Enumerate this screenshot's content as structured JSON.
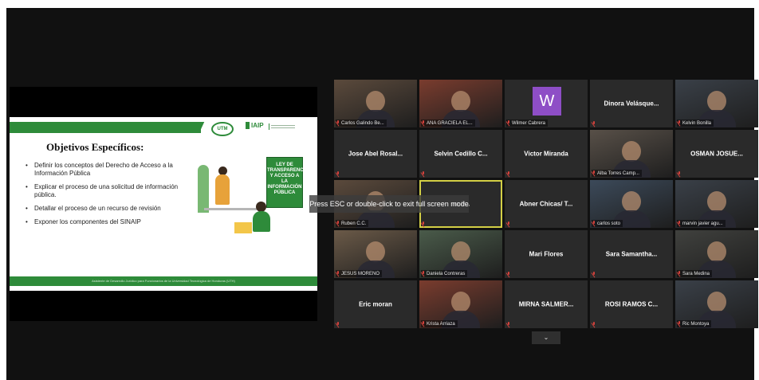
{
  "toast": "Press ESC or double-click to exit full screen mode",
  "slide": {
    "title": "Objetivos Específicos:",
    "bullets": [
      "Definir los conceptos del Derecho de Acceso a la Información Pública",
      "Explicar el proceso de una solicitud de información pública.",
      "Detallar el proceso de un recurso de revisión",
      "Exponer los componentes del SINAIP"
    ],
    "logo_utm": "UTM",
    "logo_iaip": "IAIP",
    "book_text": "LEY DE TRANSPARENCIA Y ACCESO A LA INFORMACIÓN PÚBLICA",
    "footer": "Asistente de Desarrollo Jurídico para Funcionarios de la Universidad Tecnológica de Honduras (UTH)"
  },
  "participants": [
    {
      "name": "Carlos Galindo Be...",
      "video": true,
      "label": "Carlos Galindo Be..."
    },
    {
      "name": "ANA GRACIELA EL...",
      "video": true,
      "label": "ANA GRACIELA EL..."
    },
    {
      "name": "Wilmer Cabrera",
      "avatar": "W",
      "label": "Wilmer Cabrera"
    },
    {
      "name": "Dinora Velásque...",
      "label": ""
    },
    {
      "name": "Kelvin Bonilla",
      "video": true,
      "label": "Kelvin Bonilla"
    },
    {
      "name": "Jose Abel Rosal...",
      "label": ""
    },
    {
      "name": "Selvin Cedillo C...",
      "label": ""
    },
    {
      "name": "Victor Miranda",
      "label": ""
    },
    {
      "name": "Alba Torres Camp...",
      "video": true,
      "label": "Alba Torres Camp..."
    },
    {
      "name": "OSMAN JOSUE...",
      "label": ""
    },
    {
      "name": "Ruben C.C.",
      "video": true,
      "label": "Ruben C.C."
    },
    {
      "name": "na P...",
      "label": "",
      "active": true
    },
    {
      "name": "Abner Chicas/ T...",
      "label": ""
    },
    {
      "name": "carlos soto",
      "video": true,
      "label": "carlos soto"
    },
    {
      "name": "marvin javier agu...",
      "video": true,
      "label": "marvin javier agu..."
    },
    {
      "name": "JESUS MORENO",
      "video": true,
      "label": "JESUS MORENO"
    },
    {
      "name": "Daniela Contreras",
      "video": true,
      "label": "Daniela Contreras"
    },
    {
      "name": "Mari Flores",
      "label": ""
    },
    {
      "name": "Sara Samantha...",
      "label": ""
    },
    {
      "name": "Sara Medina",
      "video": true,
      "label": "Sara Medina"
    },
    {
      "name": "Eric moran",
      "label": ""
    },
    {
      "name": "Krista Arriaza",
      "video": true,
      "label": "Krista Arriaza"
    },
    {
      "name": "MIRNA SALMER...",
      "label": ""
    },
    {
      "name": "ROSI RAMOS C...",
      "label": ""
    },
    {
      "name": "Ric Montoya",
      "video": true,
      "label": "Ric Montoya"
    }
  ],
  "colors": {
    "accent_green": "#2e8b3a",
    "active_border": "#d3cf45",
    "muted_red": "#d6423c",
    "avatar_purple": "#8e4ec6"
  },
  "icons": {
    "mic": "mic-muted-icon",
    "more": "chevron-down-icon"
  }
}
